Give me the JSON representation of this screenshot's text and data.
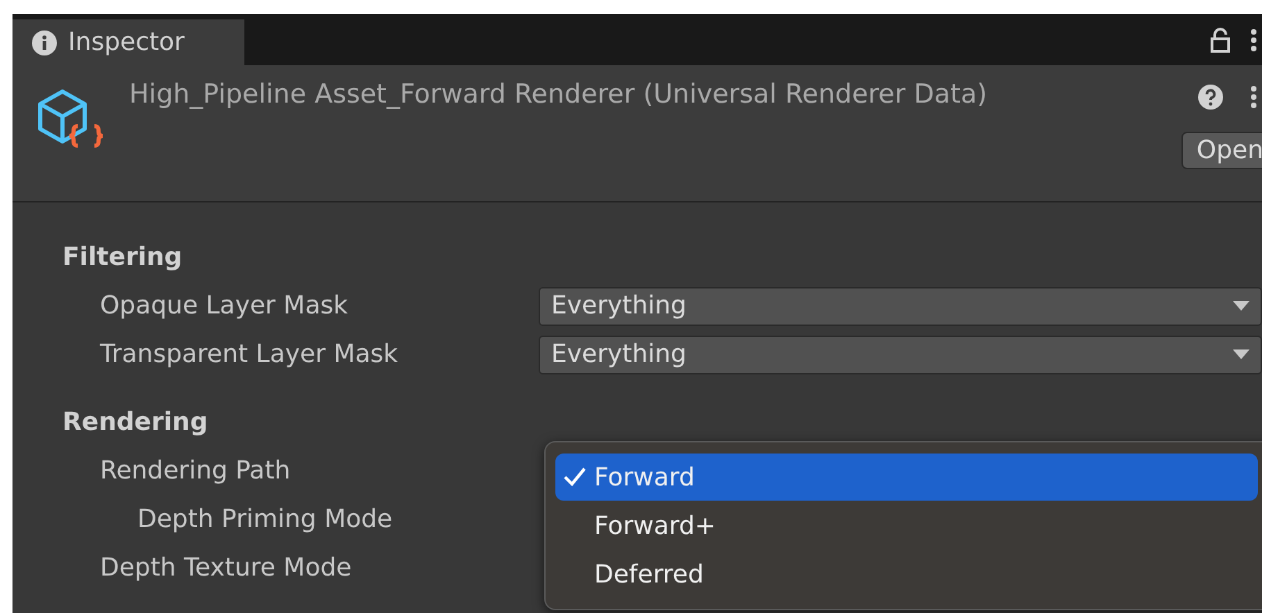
{
  "tab": {
    "label": "Inspector",
    "selected": true
  },
  "header": {
    "title": "High_Pipeline Asset_Forward Renderer (Universal Renderer Data)",
    "button": "Open"
  },
  "sections": [
    {
      "title": "Filtering",
      "rows": [
        {
          "label": "Opaque Layer Mask",
          "value": "Everything"
        },
        {
          "label": "Transparent Layer Mask",
          "value": "Everything"
        }
      ]
    },
    {
      "title": "Rendering",
      "rows": [
        {
          "label": "Rendering Path",
          "children": [
            {
              "label": "Depth Priming Mode"
            }
          ]
        },
        {
          "label": "Depth Texture Mode"
        }
      ]
    }
  ],
  "popup": {
    "items": [
      {
        "label": "Forward",
        "selected": true
      },
      {
        "label": "Forward+",
        "selected": false
      },
      {
        "label": "Deferred",
        "selected": false
      }
    ]
  }
}
